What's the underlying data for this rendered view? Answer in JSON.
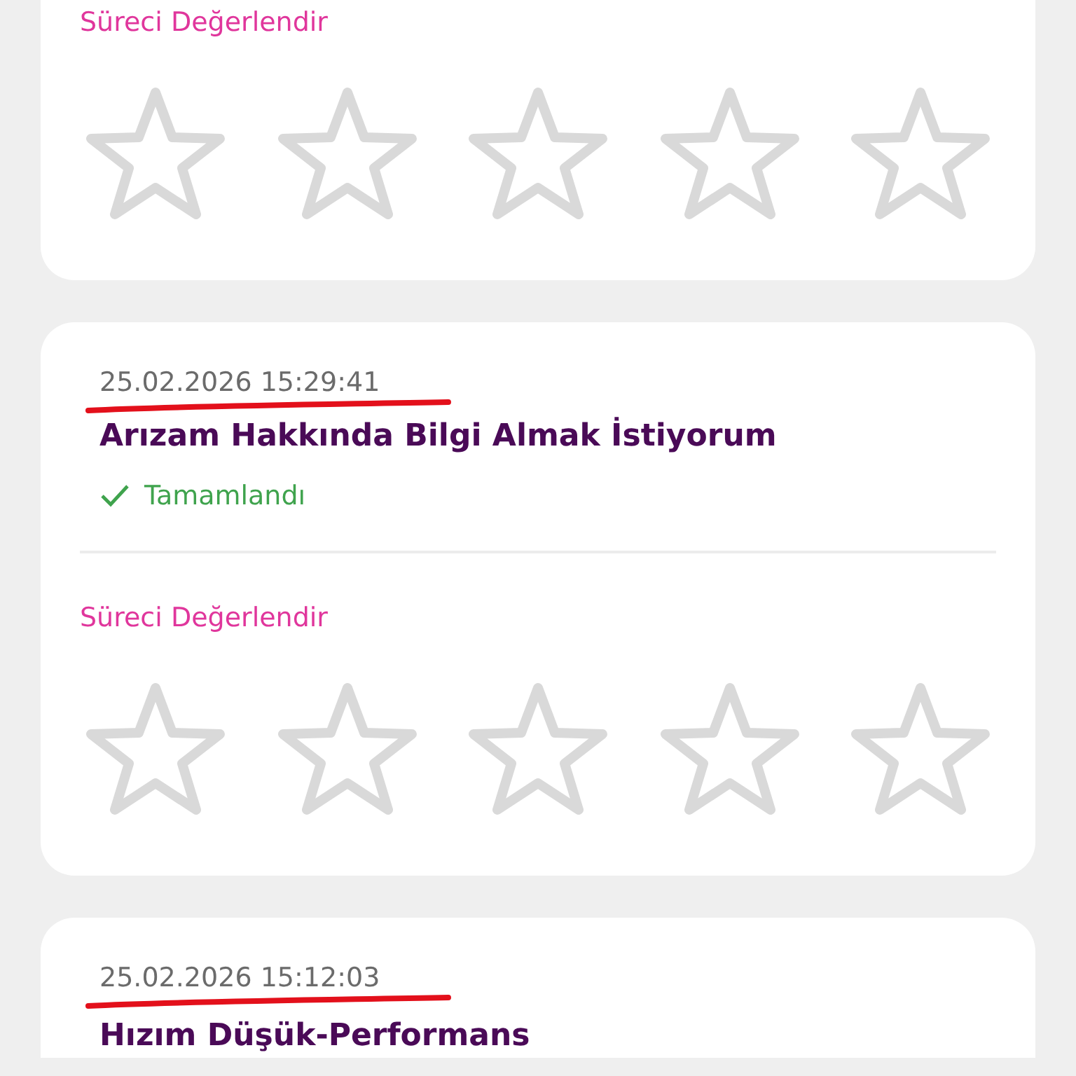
{
  "cards": [
    {
      "rating": {
        "label": "Süreci Değerlendir",
        "stars": 0
      }
    },
    {
      "date": "25.02.2026 15:29:41",
      "underlined": true,
      "title": "Arızam Hakkında Bilgi Almak İstiyorum",
      "status": {
        "text": "Tamamlandı",
        "kind": "completed"
      },
      "rating": {
        "label": "Süreci Değerlendir",
        "stars": 0
      }
    },
    {
      "date": "25.02.2026 15:12:03",
      "underlined": true,
      "title": "Hızım Düşük-Performans"
    }
  ]
}
